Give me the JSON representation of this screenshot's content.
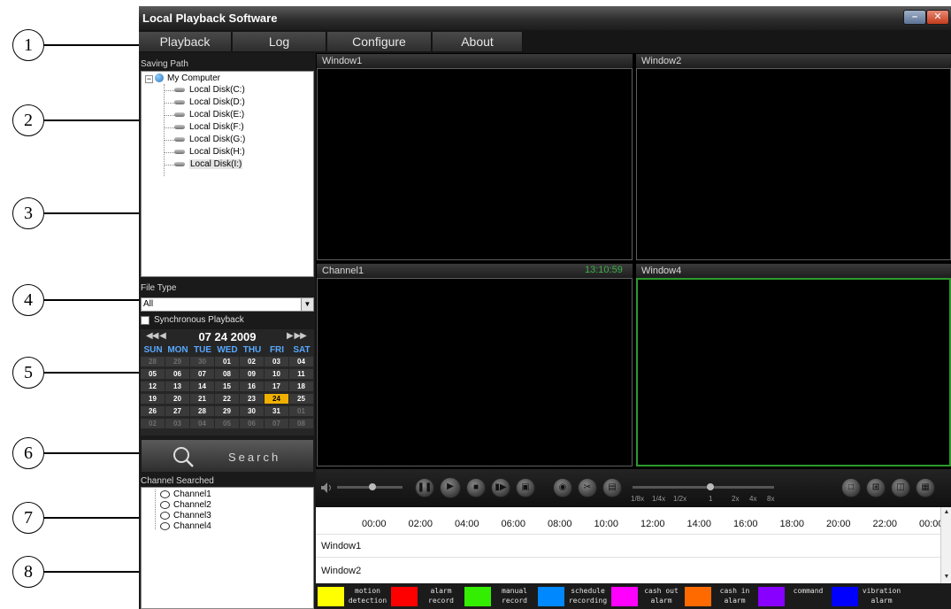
{
  "callouts": [
    "1",
    "2",
    "3",
    "4",
    "5",
    "6",
    "7",
    "8"
  ],
  "app": {
    "title": "Local Playback Software",
    "minimize_glyph": "–",
    "close_glyph": "✕"
  },
  "menu": [
    "Playback",
    "Log",
    "Configure",
    "About"
  ],
  "saving_path": {
    "label": "Saving Path",
    "root": "My Computer",
    "disks": [
      "Local Disk(C:)",
      "Local Disk(D:)",
      "Local Disk(E:)",
      "Local Disk(F:)",
      "Local Disk(G:)",
      "Local Disk(H:)",
      "Local Disk(I:)"
    ],
    "selected": "Local Disk(I:)"
  },
  "file_type": {
    "label": "File Type",
    "selected": "All",
    "arrow_glyph": "▼"
  },
  "sync_playback": {
    "label": "Synchronous Playback",
    "checked": false
  },
  "calendar": {
    "title": "07 24 2009",
    "prev_glyph": "◀◀ ◀",
    "next_glyph": "▶ ▶▶",
    "days_of_week": [
      "SUN",
      "MON",
      "TUE",
      "WED",
      "THU",
      "FRI",
      "SAT"
    ],
    "weeks": [
      [
        "28",
        "29",
        "30",
        "01",
        "02",
        "03",
        "04"
      ],
      [
        "05",
        "06",
        "07",
        "08",
        "09",
        "10",
        "11"
      ],
      [
        "12",
        "13",
        "14",
        "15",
        "16",
        "17",
        "18"
      ],
      [
        "19",
        "20",
        "21",
        "22",
        "23",
        "24",
        "25"
      ],
      [
        "26",
        "27",
        "28",
        "29",
        "30",
        "31",
        "01"
      ],
      [
        "02",
        "03",
        "04",
        "05",
        "06",
        "07",
        "08"
      ]
    ],
    "selected_day": "24",
    "colors": {
      "weekday_header": "#58a8ff",
      "selected": "#f0b000"
    }
  },
  "search": {
    "label": "Search",
    "icon": "magnifier-icon"
  },
  "channels": {
    "label": "Channel Searched",
    "items": [
      "Channel1",
      "Channel2",
      "Channel3",
      "Channel4"
    ]
  },
  "video_windows": [
    {
      "title": "Window1",
      "time": ""
    },
    {
      "title": "Window2",
      "time": ""
    },
    {
      "title": "Channel1",
      "time": "13:10:59"
    },
    {
      "title": "Window4",
      "time": "",
      "active": true
    }
  ],
  "controls": {
    "volume_icon": "speaker-icon",
    "buttons": [
      "pause-icon",
      "play-icon",
      "stop-icon",
      "step-forward-icon",
      "frame-icon",
      "snapshot-icon",
      "clip-icon",
      "save-icon"
    ],
    "speeds": [
      "1/8x",
      "1/4x",
      "1/2x",
      "1",
      "2x",
      "4x",
      "8x"
    ],
    "current_speed": "1",
    "layout_buttons": [
      "single-view-icon",
      "quad-view-icon",
      "pip-view-icon",
      "grid-view-icon"
    ]
  },
  "timeline": {
    "ticks": [
      "00:00",
      "02:00",
      "04:00",
      "06:00",
      "08:00",
      "10:00",
      "12:00",
      "14:00",
      "16:00",
      "18:00",
      "20:00",
      "22:00",
      "00:00"
    ],
    "rows": [
      "Window1",
      "Window2"
    ]
  },
  "legend": [
    {
      "label": "motion\ndetection",
      "color": "#ffff00"
    },
    {
      "label": "alarm\nrecord",
      "color": "#ff0000"
    },
    {
      "label": "manual\nrecord",
      "color": "#33ee00"
    },
    {
      "label": "schedule\nrecording",
      "color": "#0088ff"
    },
    {
      "label": "cash out\nalarm",
      "color": "#ff00ff"
    },
    {
      "label": "cash in\nalarm",
      "color": "#ff6a00"
    },
    {
      "label": "command",
      "color": "#8800ff"
    },
    {
      "label": "vibration\nalarm",
      "color": "#0000ff"
    }
  ]
}
